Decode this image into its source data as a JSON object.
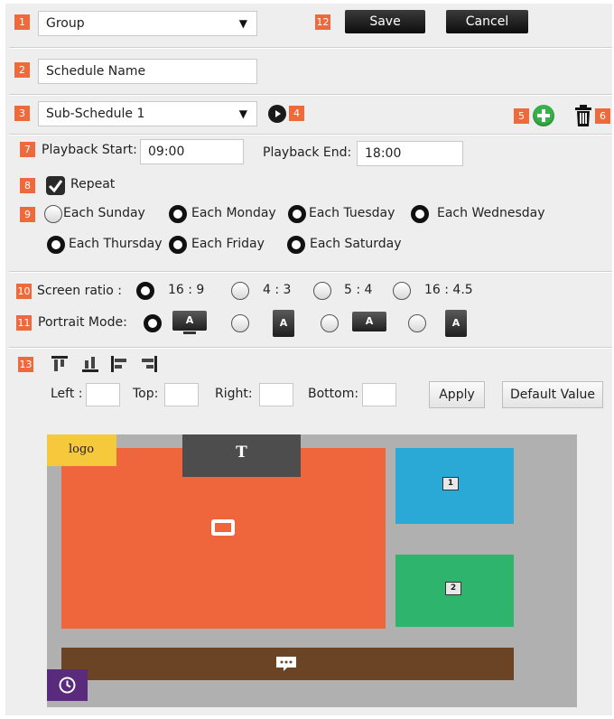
{
  "header": {
    "group_select_value": "Group",
    "save_label": "Save",
    "cancel_label": "Cancel"
  },
  "schedule_name": {
    "value": "Schedule Name"
  },
  "sub_schedule": {
    "value": "Sub-Schedule 1"
  },
  "playback": {
    "start_label": "Playback Start:",
    "start_value": "09:00",
    "end_label": "Playback End:",
    "end_value": "18:00"
  },
  "repeat": {
    "label": "Repeat",
    "checked": true
  },
  "days": [
    {
      "label": "Each Sunday",
      "selected": false
    },
    {
      "label": "Each Monday",
      "selected": true
    },
    {
      "label": "Each Tuesday",
      "selected": true
    },
    {
      "label": "Each Wednesday",
      "selected": true
    },
    {
      "label": "Each Thursday",
      "selected": true
    },
    {
      "label": "Each Friday",
      "selected": true
    },
    {
      "label": "Each Saturday",
      "selected": true
    }
  ],
  "screen_ratio": {
    "label": "Screen ratio :",
    "options": [
      "16 : 9",
      "4 : 3",
      "5 : 4",
      "16 : 4.5"
    ],
    "selected": "16 : 9"
  },
  "portrait_mode": {
    "label": "Portrait Mode:",
    "icon_letter": "A"
  },
  "margins": {
    "left_label": "Left :",
    "top_label": "Top:",
    "right_label": "Right:",
    "bottom_label": "Bottom:",
    "apply_label": "Apply",
    "default_label": "Default Value"
  },
  "markers": [
    "1",
    "2",
    "3",
    "4",
    "5",
    "6",
    "7",
    "8",
    "9",
    "10",
    "11",
    "12",
    "13"
  ],
  "layout_preview": {
    "logo_label": "logo",
    "text_zone_label": "T",
    "zone_numbers": [
      "1",
      "2"
    ]
  },
  "colors": {
    "marker": "#ee6a3c",
    "main_zone": "#f0663c",
    "zone_blue": "#2aa9d6",
    "zone_green": "#2fb46e",
    "ticker_bar": "#6b4426",
    "logo": "#f6c93c",
    "clock": "#5a2a7c",
    "text_zone": "#4d4d4d",
    "add_button": "#3bb04a"
  }
}
